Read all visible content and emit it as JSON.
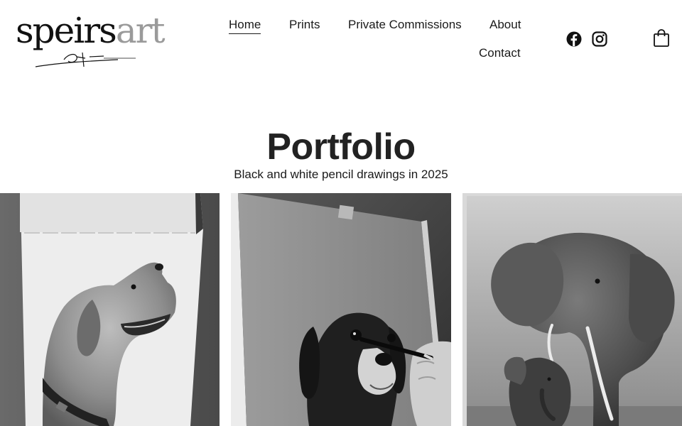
{
  "brand": {
    "logo_primary": "speirs",
    "logo_secondary": "art"
  },
  "nav": {
    "items": [
      {
        "label": "Home",
        "active": true
      },
      {
        "label": "Prints"
      },
      {
        "label": "Private Commissions"
      },
      {
        "label": "About"
      },
      {
        "label": "Contact"
      }
    ]
  },
  "social": {
    "icons": [
      "facebook-icon",
      "instagram-icon"
    ]
  },
  "cart": {
    "icon": "shopping-bag-icon"
  },
  "page": {
    "title": "Portfolio",
    "subtitle": "Black and white pencil drawings in 2025"
  },
  "gallery": {
    "items": [
      {
        "subject": "dog-profile-drawing"
      },
      {
        "subject": "spaniel-drawing-in-progress"
      },
      {
        "subject": "elephant-and-calf-drawing"
      }
    ]
  },
  "colors": {
    "text": "#1a1a1a",
    "logo_grey": "#9a9a9a",
    "background": "#ffffff"
  }
}
